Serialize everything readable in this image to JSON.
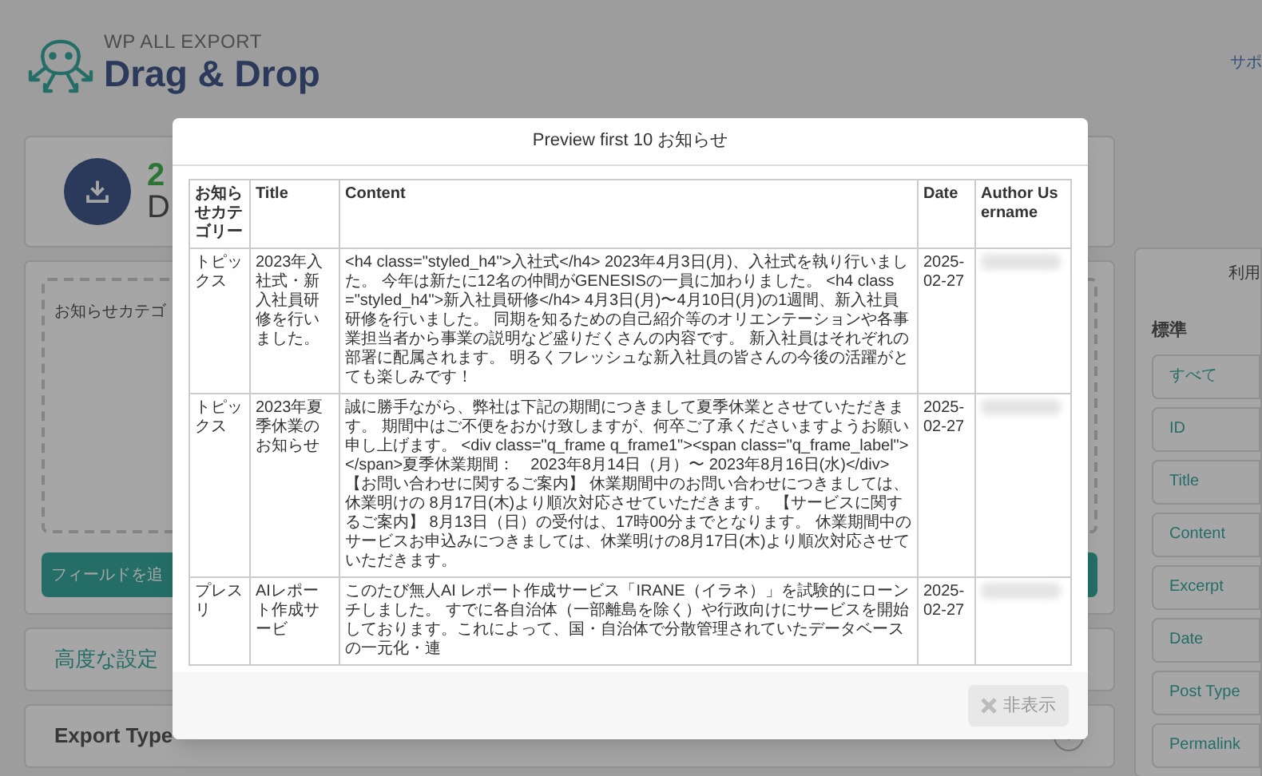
{
  "header": {
    "brand": "WP ALL EXPORT",
    "title": "Drag & Drop",
    "top_link": "サポ"
  },
  "summary": {
    "count": "2",
    "label": "D"
  },
  "field_area": {
    "label": "お知らせカテゴ"
  },
  "add_field_button": "フィールドを追",
  "sections": [
    {
      "title": "高度な設定",
      "kind": "link"
    },
    {
      "title": "Export Type",
      "kind": "collapsible"
    }
  ],
  "sidebar": {
    "header": "利用",
    "group": "標準",
    "items": [
      "すべて",
      "ID",
      "Title",
      "Content",
      "Excerpt",
      "Date",
      "Post Type",
      "Permalink"
    ]
  },
  "modal": {
    "title": "Preview first 10 お知らせ",
    "columns": [
      "お知らせカテゴリー",
      "Title",
      "Content",
      "Date",
      "Author Username"
    ],
    "rows": [
      {
        "cells": [
          "トピックス",
          "2023年入社式・新入社員研修を行いました。",
          "<h4 class=\"styled_h4\">入社式</h4> 2023年4月3日(月)、入社式を執り行いました。 今年は新たに12名の仲間がGENESISの一員に加わりました。 <h4 class=\"styled_h4\">新入社員研修</h4> 4月3日(月)〜4月10日(月)の1週間、新入社員研修を行いました。 同期を知るための自己紹介等のオリエンテーションや各事業担当者から事業の説明など盛りだくさんの内容です。 新入社員はそれぞれの部署に配属されます。 明るくフレッシュな新入社員の皆さんの今後の活躍がとても楽しみです！",
          "2025-02-27"
        ]
      },
      {
        "cells": [
          "トピックス",
          "2023年夏季休業のお知らせ",
          "誠に勝手ながら、弊社は下記の期間につきまして夏季休業とさせていただきます。 期間中はご不便をおかけ致しますが、何卒ご了承くださいますようお願い申し上げます。 <div class=\"q_frame q_frame1\"><span class=\"q_frame_label\"></span>夏季休業期間：　2023年8月14日（月）〜 2023年8月16日(水)</div> 【お問い合わせに関するご案内】 休業期間中のお問い合わせにつきましては、休業明けの 8月17日(木)より順次対応させていただきます。 【サービスに関するご案内】 8月13日（日）の受付は、17時00分までとなります。 休業期間中のサービスお申込みにつきましては、休業明けの8月17日(木)より順次対応させていただきます。",
          "2025-02-27"
        ]
      },
      {
        "cells": [
          "プレスリ",
          "AIレポート作成サービ",
          "このたび無人AI レポート作成サービス「IRANE（イラネ）」を試験的にローンチしました。 すでに各自治体（一部離島を除く）や行政向けにサービスを開始しております。これによって、国・自治体で分散管理されていたデータベースの一元化・連",
          "2025-02-27"
        ]
      }
    ],
    "close_button": "非表示"
  }
}
